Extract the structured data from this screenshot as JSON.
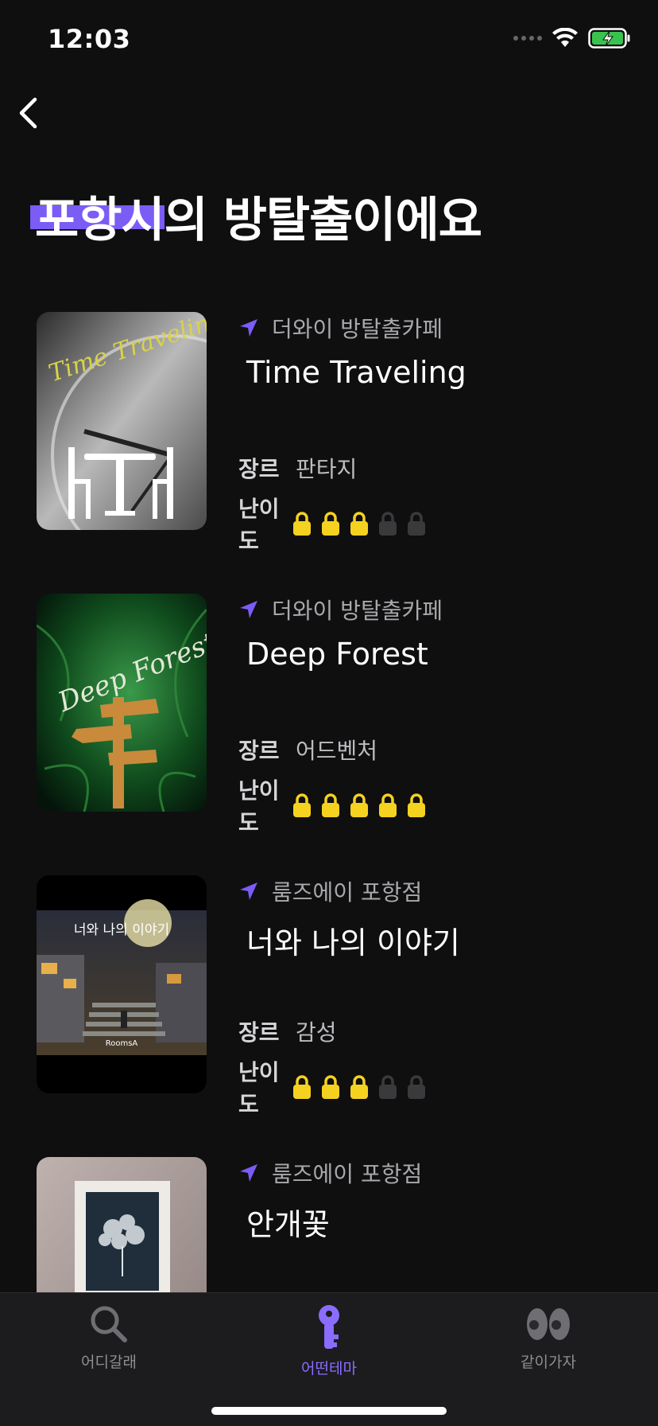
{
  "status": {
    "time": "12:03"
  },
  "page": {
    "title_highlight": "포항시",
    "title_rest": "의 방탈출이에요"
  },
  "themes": [
    {
      "cafe": "더와이 방탈출카페",
      "title": "Time Traveling",
      "genre_label": "장르",
      "genre": "판타지",
      "level_label": "난이도",
      "level": 3,
      "level_max": 5,
      "poster_text": "Time Traveling"
    },
    {
      "cafe": "더와이 방탈출카페",
      "title": "Deep Forest",
      "genre_label": "장르",
      "genre": "어드벤처",
      "level_label": "난이도",
      "level": 5,
      "level_max": 5,
      "poster_text": "Deep Forest"
    },
    {
      "cafe": "룸즈에이 포항점",
      "title": "너와 나의 이야기",
      "genre_label": "장르",
      "genre": "감성",
      "level_label": "난이도",
      "level": 3,
      "level_max": 5,
      "poster_text": "너와 나의 이야기",
      "poster_brand": "RoomsA"
    },
    {
      "cafe": "룸즈에이 포항점",
      "title": "안개꽃"
    }
  ],
  "tabs": [
    {
      "label": "어디갈래",
      "icon": "search-icon",
      "active": false
    },
    {
      "label": "어떤테마",
      "icon": "key-icon",
      "active": true
    },
    {
      "label": "같이가자",
      "icon": "eyes-icon",
      "active": false
    }
  ],
  "colors": {
    "accent": "#7b5cf5",
    "lock_on": "#f5d21f",
    "lock_off": "#3a3a3c",
    "background": "#0f0f10"
  }
}
